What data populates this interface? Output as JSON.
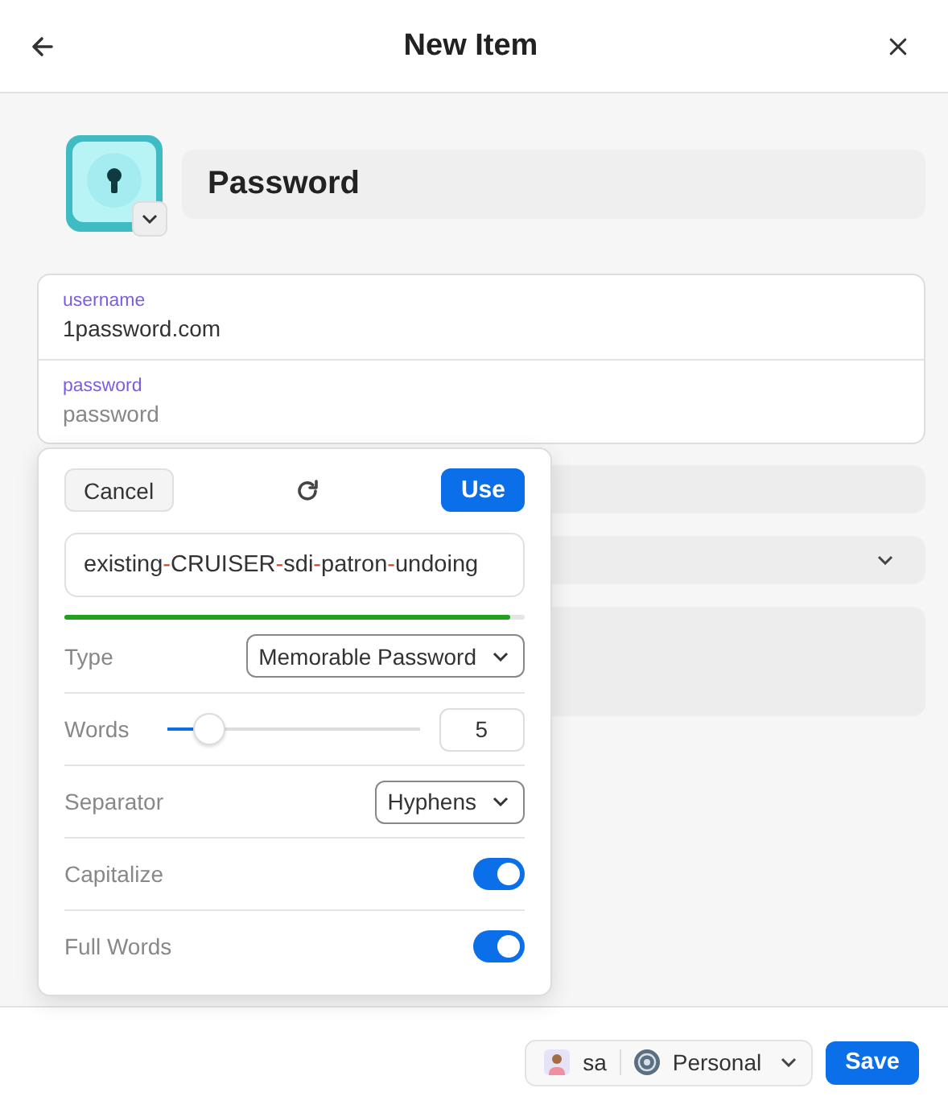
{
  "header": {
    "title": "New Item"
  },
  "item": {
    "title": "Password"
  },
  "login_fields": [
    {
      "label": "username",
      "value": "1password.com"
    },
    {
      "label": "password",
      "placeholder": "password"
    }
  ],
  "generator": {
    "cancel": "Cancel",
    "use": "Use",
    "password_parts": [
      {
        "text": "existing",
        "kind": "word"
      },
      {
        "text": "-",
        "kind": "separator"
      },
      {
        "text": "CRUISER",
        "kind": "word"
      },
      {
        "text": "-",
        "kind": "separator"
      },
      {
        "text": "sdi",
        "kind": "word"
      },
      {
        "text": "-",
        "kind": "separator"
      },
      {
        "text": "patron",
        "kind": "word"
      },
      {
        "text": "-",
        "kind": "separator"
      },
      {
        "text": "undoing",
        "kind": "word"
      }
    ],
    "strength": {
      "level": 0.97
    },
    "options": [
      {
        "kind": "select",
        "label": "Type",
        "value": "Memorable Password"
      },
      {
        "kind": "slider",
        "label": "Words",
        "level": 0.2,
        "value": "5"
      },
      {
        "kind": "select",
        "label": "Separator",
        "value": "Hyphens"
      },
      {
        "kind": "toggle",
        "label": "Capitalize",
        "on": true
      },
      {
        "kind": "toggle",
        "label": "Full Words",
        "on": true
      }
    ]
  },
  "footer": {
    "account": "sa",
    "vault": "Personal",
    "save": "Save"
  }
}
